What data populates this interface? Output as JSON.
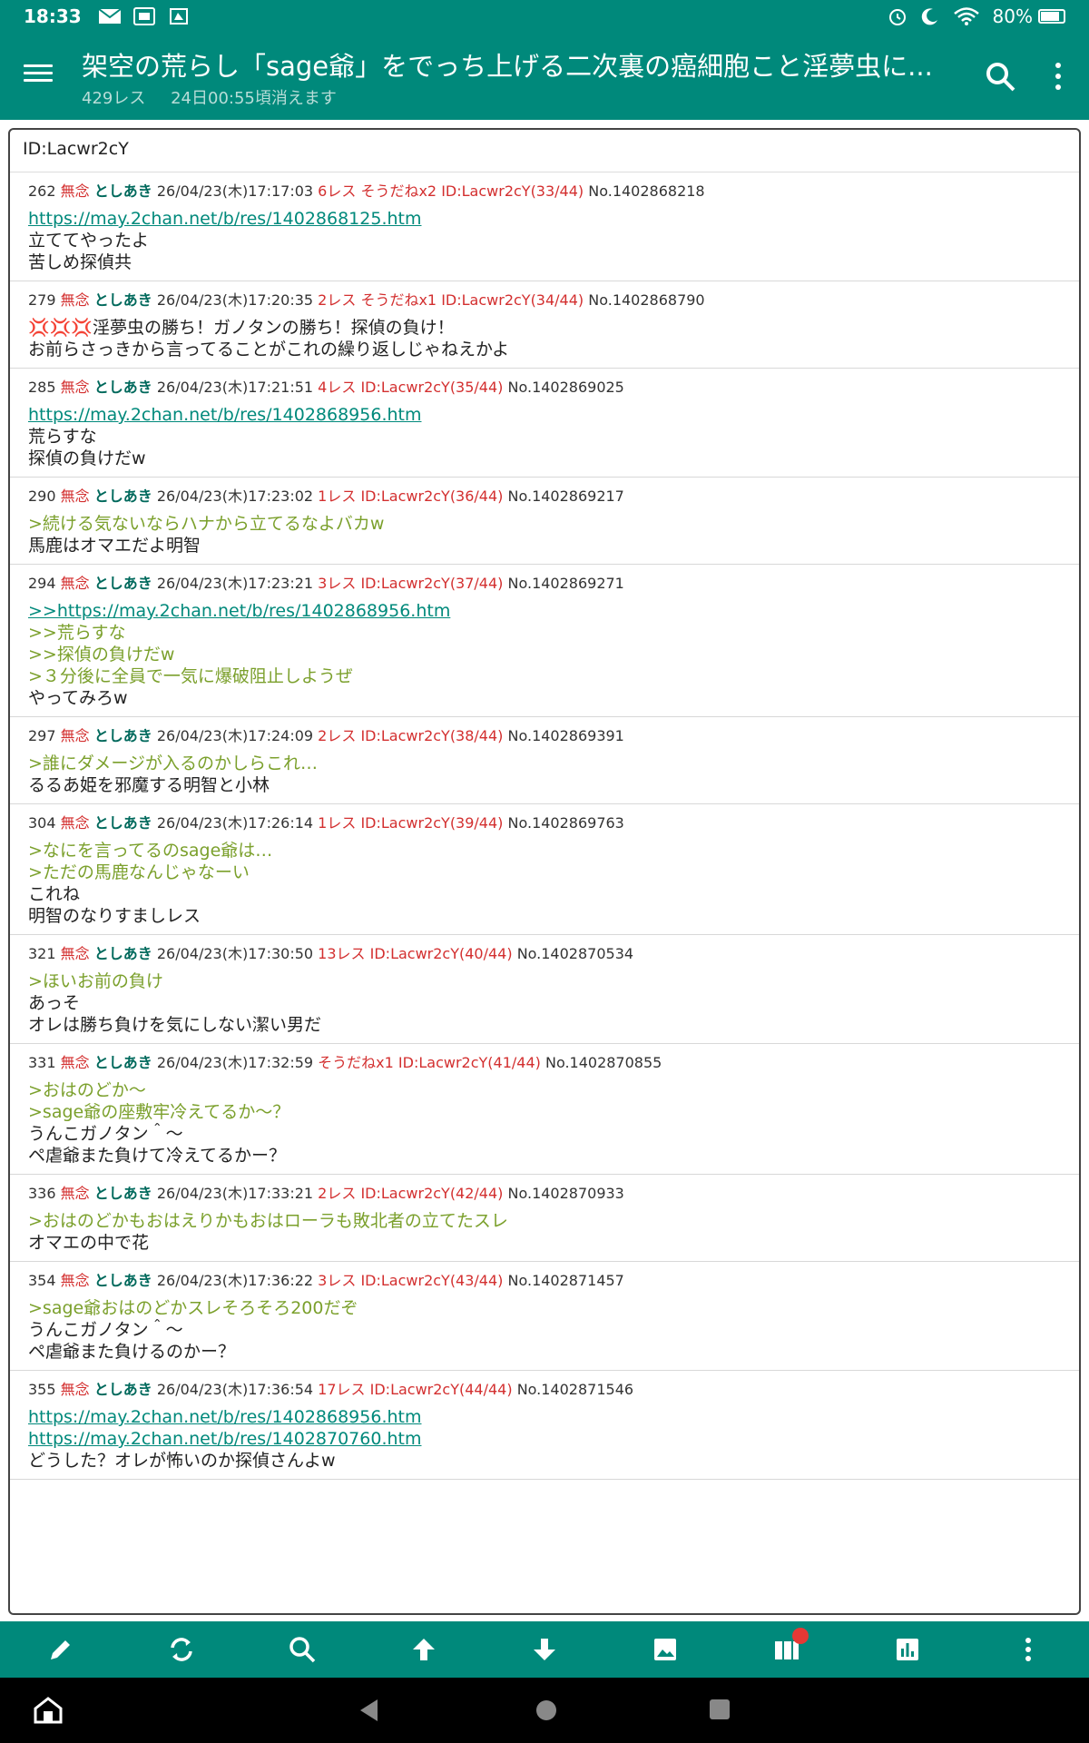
{
  "status_bar": {
    "time": "18:33",
    "battery": "80%"
  },
  "app_bar": {
    "title": "架空の荒らし「sage爺」をでっち上げる二次裏の癌細胞こと淫夢虫に...",
    "res_count": "429レス",
    "expires": "24日00:55頃消えます"
  },
  "popup": {
    "header": "ID:Lacwr2cY"
  },
  "posts": [
    {
      "num": "262",
      "nm": "無念",
      "author": "としあき",
      "date": "26/04/23(木)17:17:03",
      "res": "6レス",
      "sou": "そうだねx2",
      "id": "ID:Lacwr2cY(33/44)",
      "no": "No.1402868218",
      "lines": [
        {
          "t": "link",
          "v": "https://may.2chan.net/b/res/1402868125.htm"
        },
        {
          "t": "text",
          "v": "立ててやったよ"
        },
        {
          "t": "text",
          "v": "苦しめ探偵共"
        }
      ]
    },
    {
      "num": "279",
      "nm": "無念",
      "author": "としあき",
      "date": "26/04/23(木)17:20:35",
      "res": "2レス",
      "sou": "そうだねx1",
      "id": "ID:Lacwr2cY(34/44)",
      "no": "No.1402868790",
      "lines": [
        {
          "t": "text",
          "v": "💢💢💢淫夢虫の勝ち！ガノタンの勝ち！探偵の負け！"
        },
        {
          "t": "text",
          "v": "お前らさっきから言ってることがこれの繰り返しじゃねえかよ"
        }
      ]
    },
    {
      "num": "285",
      "nm": "無念",
      "author": "としあき",
      "date": "26/04/23(木)17:21:51",
      "res": "4レス",
      "sou": "",
      "id": "ID:Lacwr2cY(35/44)",
      "no": "No.1402869025",
      "lines": [
        {
          "t": "link",
          "v": "https://may.2chan.net/b/res/1402868956.htm"
        },
        {
          "t": "text",
          "v": "荒らすな"
        },
        {
          "t": "text",
          "v": "探偵の負けだw"
        }
      ]
    },
    {
      "num": "290",
      "nm": "無念",
      "author": "としあき",
      "date": "26/04/23(木)17:23:02",
      "res": "1レス",
      "sou": "",
      "id": "ID:Lacwr2cY(36/44)",
      "no": "No.1402869217",
      "lines": [
        {
          "t": "quote",
          "v": ">続ける気ないならハナから立てるなよバカw"
        },
        {
          "t": "text",
          "v": "馬鹿はオマエだよ明智"
        }
      ]
    },
    {
      "num": "294",
      "nm": "無念",
      "author": "としあき",
      "date": "26/04/23(木)17:23:21",
      "res": "3レス",
      "sou": "",
      "id": "ID:Lacwr2cY(37/44)",
      "no": "No.1402869271",
      "lines": [
        {
          "t": "link",
          "v": ">>https://may.2chan.net/b/res/1402868956.htm"
        },
        {
          "t": "quote",
          "v": ">>荒らすな"
        },
        {
          "t": "quote",
          "v": ">>探偵の負けだw"
        },
        {
          "t": "quote",
          "v": ">３分後に全員で一気に爆破阻止しようぜ"
        },
        {
          "t": "text",
          "v": "やってみろw"
        }
      ]
    },
    {
      "num": "297",
      "nm": "無念",
      "author": "としあき",
      "date": "26/04/23(木)17:24:09",
      "res": "2レス",
      "sou": "",
      "id": "ID:Lacwr2cY(38/44)",
      "no": "No.1402869391",
      "lines": [
        {
          "t": "quote",
          "v": ">誰にダメージが入るのかしらこれ…"
        },
        {
          "t": "text",
          "v": "るるあ姫を邪魔する明智と小林"
        }
      ]
    },
    {
      "num": "304",
      "nm": "無念",
      "author": "としあき",
      "date": "26/04/23(木)17:26:14",
      "res": "1レス",
      "sou": "",
      "id": "ID:Lacwr2cY(39/44)",
      "no": "No.1402869763",
      "lines": [
        {
          "t": "quote",
          "v": ">なにを言ってるのsage爺は…"
        },
        {
          "t": "quote",
          "v": ">ただの馬鹿なんじゃなーい"
        },
        {
          "t": "text",
          "v": "これね"
        },
        {
          "t": "text",
          "v": "明智のなりすましレス"
        }
      ]
    },
    {
      "num": "321",
      "nm": "無念",
      "author": "としあき",
      "date": "26/04/23(木)17:30:50",
      "res": "13レス",
      "sou": "",
      "id": "ID:Lacwr2cY(40/44)",
      "no": "No.1402870534",
      "lines": [
        {
          "t": "quote",
          "v": ">ほいお前の負け"
        },
        {
          "t": "text",
          "v": "あっそ"
        },
        {
          "t": "text",
          "v": "オレは勝ち負けを気にしない潔い男だ"
        }
      ]
    },
    {
      "num": "331",
      "nm": "無念",
      "author": "としあき",
      "date": "26/04/23(木)17:32:59",
      "res": "",
      "sou": "そうだねx1",
      "id": "ID:Lacwr2cY(41/44)",
      "no": "No.1402870855",
      "lines": [
        {
          "t": "quote",
          "v": ">おはのどか〜"
        },
        {
          "t": "quote",
          "v": ">sage爺の座敷牢冷えてるか〜？"
        },
        {
          "t": "text",
          "v": "うんこガノタン＾〜"
        },
        {
          "t": "text",
          "v": "ペ虐爺また負けて冷えてるかー？"
        }
      ]
    },
    {
      "num": "336",
      "nm": "無念",
      "author": "としあき",
      "date": "26/04/23(木)17:33:21",
      "res": "2レス",
      "sou": "",
      "id": "ID:Lacwr2cY(42/44)",
      "no": "No.1402870933",
      "lines": [
        {
          "t": "quote",
          "v": ">おはのどかもおはえりかもおはローラも敗北者の立てたスレ"
        },
        {
          "t": "text",
          "v": "オマエの中で花"
        }
      ]
    },
    {
      "num": "354",
      "nm": "無念",
      "author": "としあき",
      "date": "26/04/23(木)17:36:22",
      "res": "3レス",
      "sou": "",
      "id": "ID:Lacwr2cY(43/44)",
      "no": "No.1402871457",
      "lines": [
        {
          "t": "quote",
          "v": ">sage爺おはのどかスレそろそろ200だぞ"
        },
        {
          "t": "text",
          "v": "うんこガノタン＾〜"
        },
        {
          "t": "text",
          "v": "ペ虐爺また負けるのかー？"
        }
      ]
    },
    {
      "num": "355",
      "nm": "無念",
      "author": "としあき",
      "date": "26/04/23(木)17:36:54",
      "res": "17レス",
      "sou": "",
      "id": "ID:Lacwr2cY(44/44)",
      "no": "No.1402871546",
      "lines": [
        {
          "t": "link",
          "v": "https://may.2chan.net/b/res/1402868956.htm"
        },
        {
          "t": "link",
          "v": "https://may.2chan.net/b/res/1402870760.htm"
        },
        {
          "t": "text",
          "v": "どうした？オレが怖いのか探偵さんよw"
        }
      ]
    }
  ],
  "toolbar": {
    "icons": [
      "pencil-icon",
      "refresh-icon",
      "search-icon",
      "arrow-up-icon",
      "arrow-down-icon",
      "image-icon",
      "catalog-icon",
      "chart-icon",
      "more-vert-icon"
    ]
  },
  "colors": {
    "primary": "#00897b",
    "quote": "#7ba02c",
    "red": "#d32f2f",
    "author": "#00695c"
  }
}
